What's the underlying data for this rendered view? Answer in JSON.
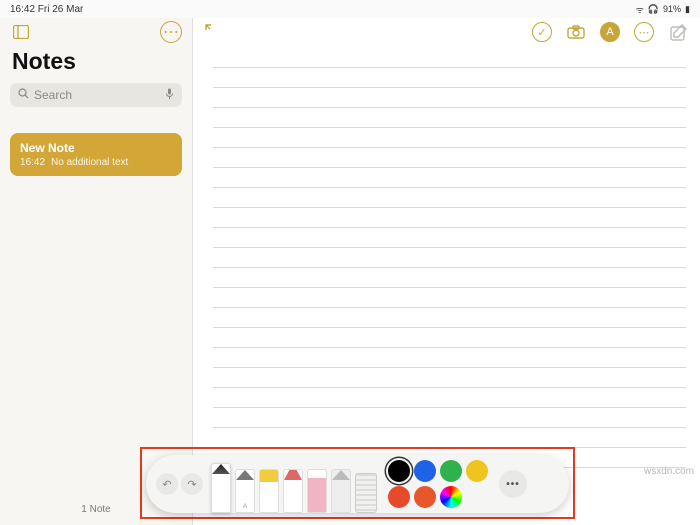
{
  "status": {
    "time": "16:42 Fri 26 Mar",
    "battery": "91%",
    "wifi": "●",
    "audio": "♫"
  },
  "sidebar": {
    "title": "Notes",
    "search_placeholder": "Search",
    "note": {
      "title": "New Note",
      "time": "16:42",
      "subtitle": "No additional text"
    },
    "footer": "1 Note"
  },
  "toolbar": {
    "check": "✓",
    "camera": "◯",
    "markup": "A",
    "more": "⋯",
    "compose": "✎"
  },
  "palette": {
    "undo": "↶",
    "redo": "↷",
    "tools": [
      {
        "name": "pen",
        "label": "",
        "selected": true
      },
      {
        "name": "pencil",
        "label": "A"
      },
      {
        "name": "marker",
        "label": ""
      },
      {
        "name": "crayon",
        "label": ""
      },
      {
        "name": "eraser",
        "label": ""
      },
      {
        "name": "lasso",
        "label": ""
      }
    ],
    "colors": [
      {
        "hex": "#000000",
        "selected": true
      },
      {
        "hex": "#1e62e6"
      },
      {
        "hex": "#2fb24b"
      },
      {
        "hex": "#f0c41f"
      },
      {
        "hex": "#e74a2b"
      },
      {
        "hex": "#e8572b"
      },
      {
        "hex": "conic"
      },
      {
        "hex": ""
      }
    ],
    "more": "•••"
  },
  "watermark": "wsxdn.com"
}
